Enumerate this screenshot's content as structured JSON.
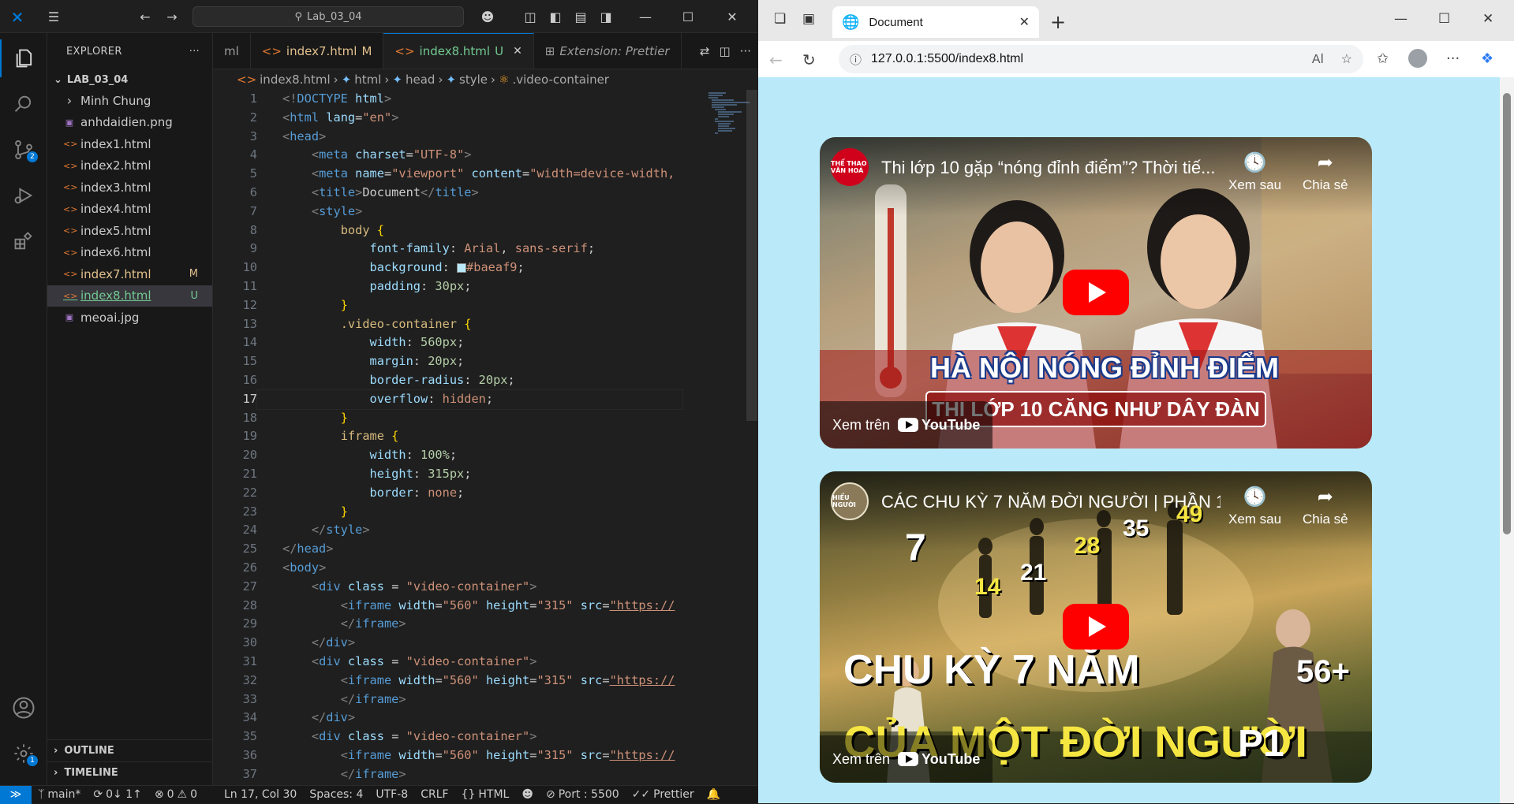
{
  "vscode": {
    "search_text": "Lab_03_04",
    "explorer": {
      "title": "EXPLORER",
      "folder": "LAB_03_04",
      "items": [
        {
          "name": "Minh Chung",
          "type": "folder",
          "status": ""
        },
        {
          "name": "anhdaidien.png",
          "type": "image",
          "status": ""
        },
        {
          "name": "index1.html",
          "type": "html",
          "status": ""
        },
        {
          "name": "index2.html",
          "type": "html",
          "status": ""
        },
        {
          "name": "index3.html",
          "type": "html",
          "status": ""
        },
        {
          "name": "index4.html",
          "type": "html",
          "status": ""
        },
        {
          "name": "index5.html",
          "type": "html",
          "status": ""
        },
        {
          "name": "index6.html",
          "type": "html",
          "status": ""
        },
        {
          "name": "index7.html",
          "type": "html",
          "status": "M"
        },
        {
          "name": "index8.html",
          "type": "html",
          "status": "U"
        },
        {
          "name": "meoai.jpg",
          "type": "image",
          "status": ""
        }
      ],
      "outline": "OUTLINE",
      "timeline": "TIMELINE"
    },
    "tabs": [
      {
        "label": "ml",
        "status": ""
      },
      {
        "label": "index7.html",
        "status": "M"
      },
      {
        "label": "index8.html",
        "status": "U"
      },
      {
        "label": "Extension: Prettier",
        "status": ""
      }
    ],
    "breadcrumb": [
      "index8.html",
      "html",
      "head",
      "style",
      ".video-container"
    ],
    "badges": {
      "source_control": "2",
      "accounts": "1"
    },
    "status": {
      "branch": "main*",
      "sync": "0↓ 1↑",
      "problems": "0",
      "warnings": "0",
      "cursor": "Ln 17, Col 30",
      "spaces": "Spaces: 4",
      "encoding": "UTF-8",
      "eol": "CRLF",
      "language": "HTML",
      "port": "Port : 5500",
      "formatter": "Prettier"
    }
  },
  "browser": {
    "tab_title": "Document",
    "url_host": "127.0.0.1",
    "url_rest": ":5500/index8.html",
    "page_bg": "#baeaf9",
    "videos": [
      {
        "title": "Thi lớp 10 gặp “nóng đỉnh điểm”? Thời tiế...",
        "channel_logo": "THỂ THAO VĂN HOÁ",
        "watch_later": "Xem sau",
        "share": "Chia sẻ",
        "watch_on": "Xem trên",
        "youtube": "YouTube",
        "headline1": "HÀ NỘI NÓNG ĐỈNH ĐIỂM",
        "headline2": "THI LỚP 10 CĂNG NHƯ DÂY ĐÀN"
      },
      {
        "title": "CÁC CHU KỲ 7 NĂM ĐỜI NGƯỜI | PHẦN 1...",
        "channel_logo": "HIỂU NGƯỜI",
        "watch_later": "Xem sau",
        "share": "Chia sẻ",
        "watch_on": "Xem trên",
        "youtube": "YouTube",
        "numbers": [
          "7",
          "14",
          "21",
          "28",
          "35",
          "49",
          "56+"
        ],
        "headline1": "CHU KỲ 7 NĂM",
        "headline2": "CỦA MỘT ĐỜI NGƯỜI",
        "part": "P1"
      }
    ]
  }
}
